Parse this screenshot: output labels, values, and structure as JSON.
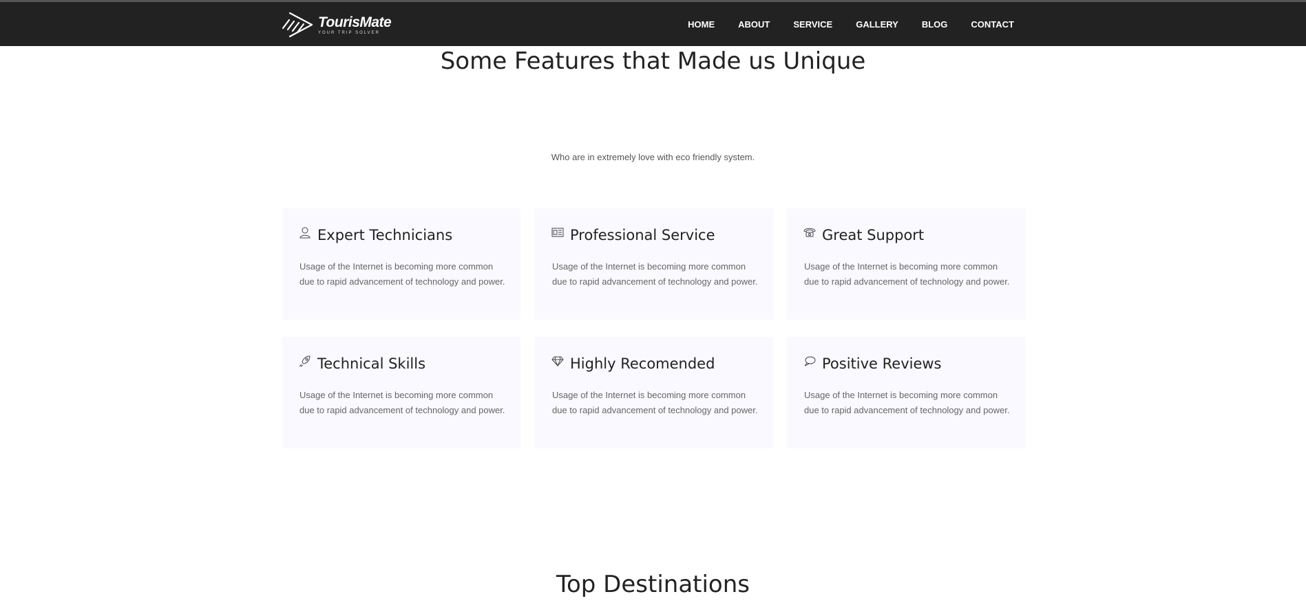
{
  "brand": {
    "name": "TourisMate",
    "tagline": "YOUR TRIP SOLVER"
  },
  "nav": [
    "HOME",
    "ABOUT",
    "SERVICE",
    "GALLERY",
    "BLOG",
    "CONTACT"
  ],
  "features": {
    "title": "Some Features that Made us Unique",
    "subtitle": "Who are in extremely love with eco friendly system.",
    "cards": [
      {
        "icon": "user-icon",
        "title": "Expert Technicians",
        "text": "Usage of the Internet is becoming more common due to rapid advancement of technology and power."
      },
      {
        "icon": "license-icon",
        "title": "Professional Service",
        "text": "Usage of the Internet is becoming more common due to rapid advancement of technology and power."
      },
      {
        "icon": "phone-icon",
        "title": "Great Support",
        "text": "Usage of the Internet is becoming more common due to rapid advancement of technology and power."
      },
      {
        "icon": "rocket-icon",
        "title": "Technical Skills",
        "text": "Usage of the Internet is becoming more common due to rapid advancement of technology and power."
      },
      {
        "icon": "diamond-icon",
        "title": "Highly Recomended",
        "text": "Usage of the Internet is becoming more common due to rapid advancement of technology and power."
      },
      {
        "icon": "bubble-icon",
        "title": "Positive Reviews",
        "text": "Usage of the Internet is becoming more common due to rapid advancement of technology and power."
      }
    ]
  },
  "destinations": {
    "title": "Top Destinations"
  },
  "colors": {
    "header_bg": "#222222",
    "card_bg": "#f9f9ff"
  }
}
